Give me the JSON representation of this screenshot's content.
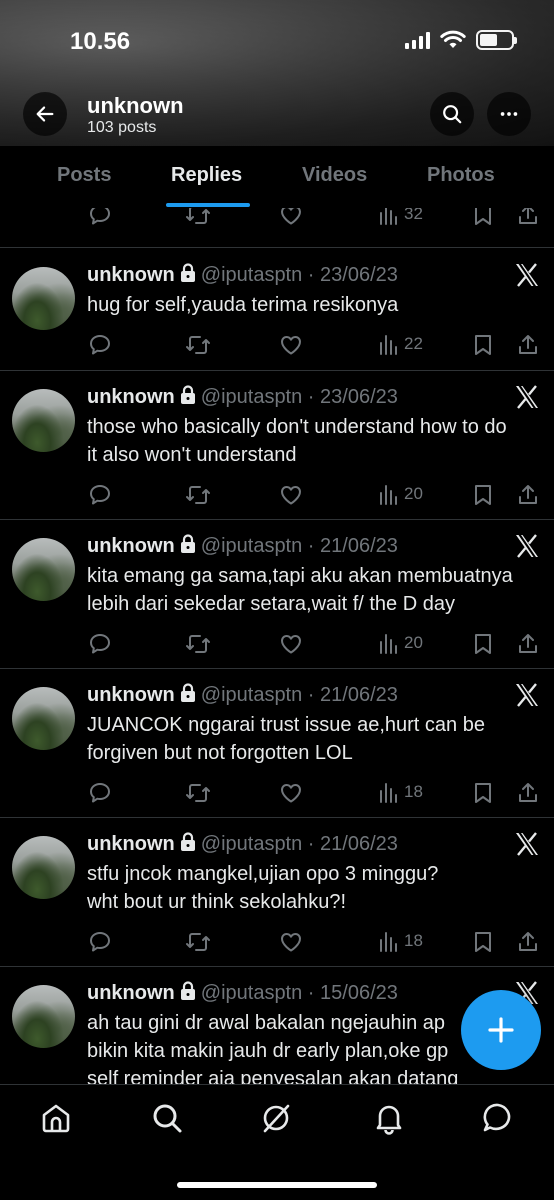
{
  "status_bar": {
    "time": "10.56"
  },
  "profile": {
    "name": "unknown",
    "post_count": "103 posts"
  },
  "tabs": [
    {
      "label": "Posts",
      "active": false
    },
    {
      "label": "Replies",
      "active": true
    },
    {
      "label": "Videos",
      "active": false
    },
    {
      "label": "Photos",
      "active": false
    }
  ],
  "partial_post": {
    "views": "32"
  },
  "posts": [
    {
      "name": "unknown",
      "handle": "@iputasptn",
      "date": "23/06/23",
      "lines": [
        "hug for self,yauda terima resikonya"
      ],
      "views": "22"
    },
    {
      "name": "unknown",
      "handle": "@iputasptn",
      "date": "23/06/23",
      "lines": [
        "those who basically don't understand how to do",
        "it also won't understand"
      ],
      "views": "20"
    },
    {
      "name": "unknown",
      "handle": "@iputasptn",
      "date": "21/06/23",
      "lines": [
        "kita emang ga sama,tapi aku akan membuatnya",
        "lebih dari sekedar setara,wait f/ the D day"
      ],
      "views": "20"
    },
    {
      "name": "unknown",
      "handle": "@iputasptn",
      "date": "21/06/23",
      "lines": [
        "JUANCOK nggarai trust issue ae,hurt can be",
        "forgiven but not forgotten LOL"
      ],
      "views": "18"
    },
    {
      "name": "unknown",
      "handle": "@iputasptn",
      "date": "21/06/23",
      "lines": [
        "stfu jncok mangkel,ujian opo 3 minggu?",
        "wht bout ur think sekolahku?!"
      ],
      "views": "18"
    },
    {
      "name": "unknown",
      "handle": "@iputasptn",
      "date": "15/06/23",
      "lines": [
        "ah tau gini dr awal bakalan ngejauhin ap",
        "bikin kita makin jauh dr early plan,oke gp",
        "self reminder aja penyesalan akan datang"
      ],
      "views": ""
    }
  ],
  "colors": {
    "accent": "#1d9bf0",
    "muted": "#71767b",
    "divider": "#2f3336"
  }
}
